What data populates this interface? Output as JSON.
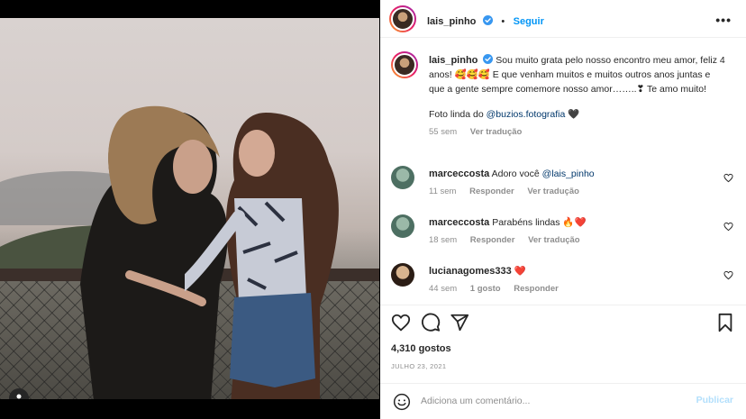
{
  "header": {
    "username": "lais_pinho",
    "follow_label": "Seguir",
    "dot": "•",
    "more_label": "•••"
  },
  "caption": {
    "username": "lais_pinho",
    "text": "Sou muito grata pelo nosso encontro meu amor, feliz 4 anos! 🥰🥰🥰 E que venham muitos e muitos outros anos juntas e que a gente sempre comemore nosso amor……..❣ Te amo muito!",
    "credit_prefix": "Foto linda do ",
    "credit_mention": "@buzios.fotografia",
    "credit_suffix": " 🖤",
    "time": "55 sem",
    "translate": "Ver tradução"
  },
  "comments": [
    {
      "username": "marceccosta",
      "text": "Adoro você ",
      "mention": "@lais_pinho",
      "time": "11 sem",
      "reply": "Responder",
      "translate": "Ver tradução",
      "likes": "",
      "avatar_color": "#6b9a8a"
    },
    {
      "username": "marceccosta",
      "text": "Parabéns lindas 🔥❤️",
      "mention": "",
      "time": "18 sem",
      "reply": "Responder",
      "translate": "Ver tradução",
      "likes": "",
      "avatar_color": "#6b9a8a"
    },
    {
      "username": "lucianagomes333",
      "text": "❤️",
      "mention": "",
      "time": "44 sem",
      "reply": "Responder",
      "translate": "",
      "likes": "1 gosto",
      "avatar_color": "#7a5a3e"
    }
  ],
  "actions": {
    "likes": "4,310 gostos",
    "date": "JULHO 23, 2021"
  },
  "add_comment": {
    "placeholder": "Adiciona um comentário...",
    "publish_label": "Publicar"
  },
  "colors": {
    "accent": "#0095f6",
    "verified": "#3897f0",
    "publish_disabled": "#b2dffc",
    "meta_gray": "#8e8e8e"
  },
  "icons": {
    "header": [
      "verified-badge-icon",
      "more-options-icon"
    ],
    "actions": [
      "heart-icon",
      "comment-icon",
      "share-icon",
      "bookmark-icon"
    ],
    "photo": [
      "tag-user-icon"
    ],
    "comment": [
      "comment-like-icon",
      "emoji-icon"
    ]
  }
}
